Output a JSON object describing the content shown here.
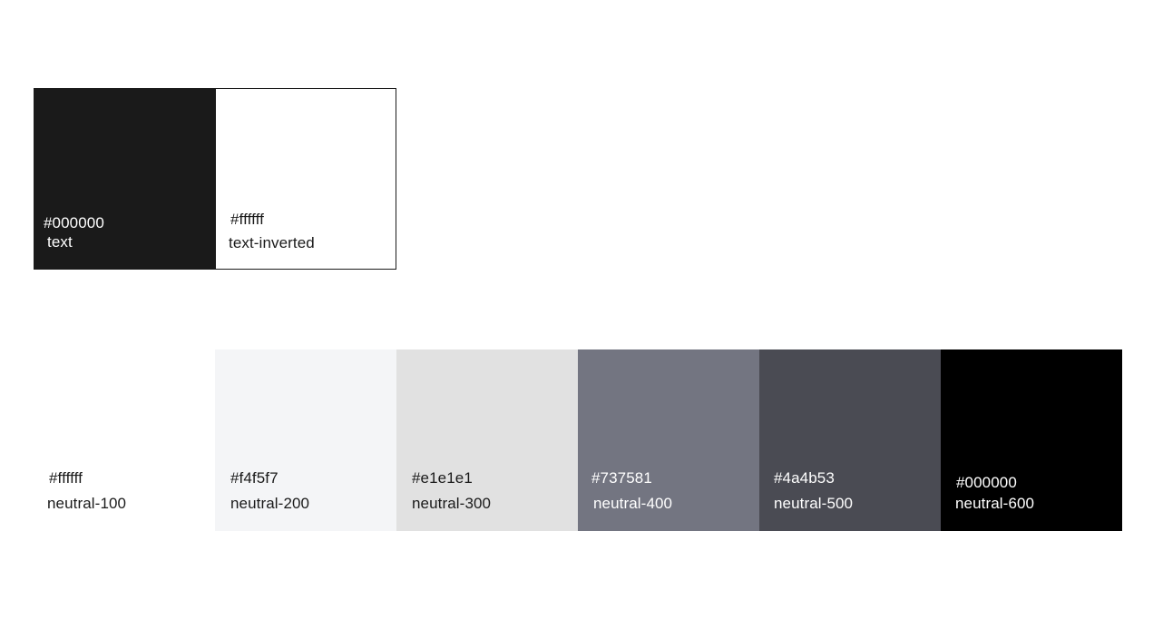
{
  "text_colors": [
    {
      "hex": "#000000",
      "name": "text",
      "fill": "#1a1a1a"
    },
    {
      "hex": "#ffffff",
      "name": "text-inverted",
      "fill": "#ffffff"
    }
  ],
  "neutrals": [
    {
      "hex": "#ffffff",
      "name": "neutral-100",
      "fill": "#ffffff"
    },
    {
      "hex": "#f4f5f7",
      "name": "neutral-200",
      "fill": "#f4f5f7"
    },
    {
      "hex": "#e1e1e1",
      "name": "neutral-300",
      "fill": "#e1e1e1"
    },
    {
      "hex": "#737581",
      "name": "neutral-400",
      "fill": "#737581"
    },
    {
      "hex": "#4a4b53",
      "name": "neutral-500",
      "fill": "#4a4b53"
    },
    {
      "hex": "#000000",
      "name": "neutral-600",
      "fill": "#000000"
    }
  ]
}
